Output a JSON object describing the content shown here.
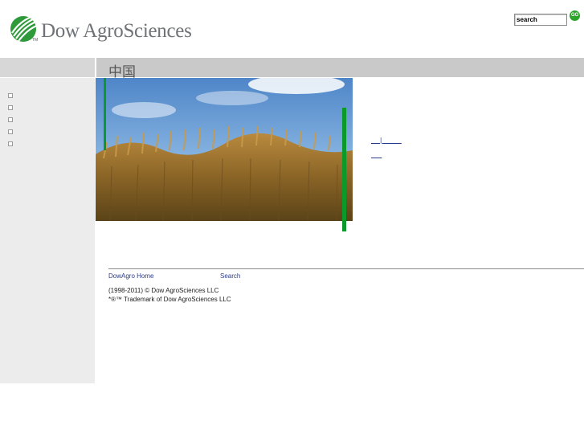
{
  "header": {
    "brand": "Dow AgroSciences",
    "tm": "TM",
    "search": {
      "placeholder": "search",
      "go_label": "GO"
    }
  },
  "title_bar": {
    "title": "中国"
  },
  "sidebar": {
    "items": [
      "",
      "",
      "",
      "",
      ""
    ]
  },
  "content": {
    "links": [
      "__ | _____",
      "___"
    ]
  },
  "footer": {
    "links": [
      "DowAgro Home",
      "Search"
    ],
    "copyright": "(1998-2011) © Dow AgroSciences LLC",
    "trademark": "*®™ Trademark of Dow AgroSciences LLC"
  },
  "colors": {
    "accent_green": "#0a9a2a",
    "title_bar": "#c9c9c9",
    "sidebar": "#ececec",
    "link": "#2a3a8a"
  }
}
